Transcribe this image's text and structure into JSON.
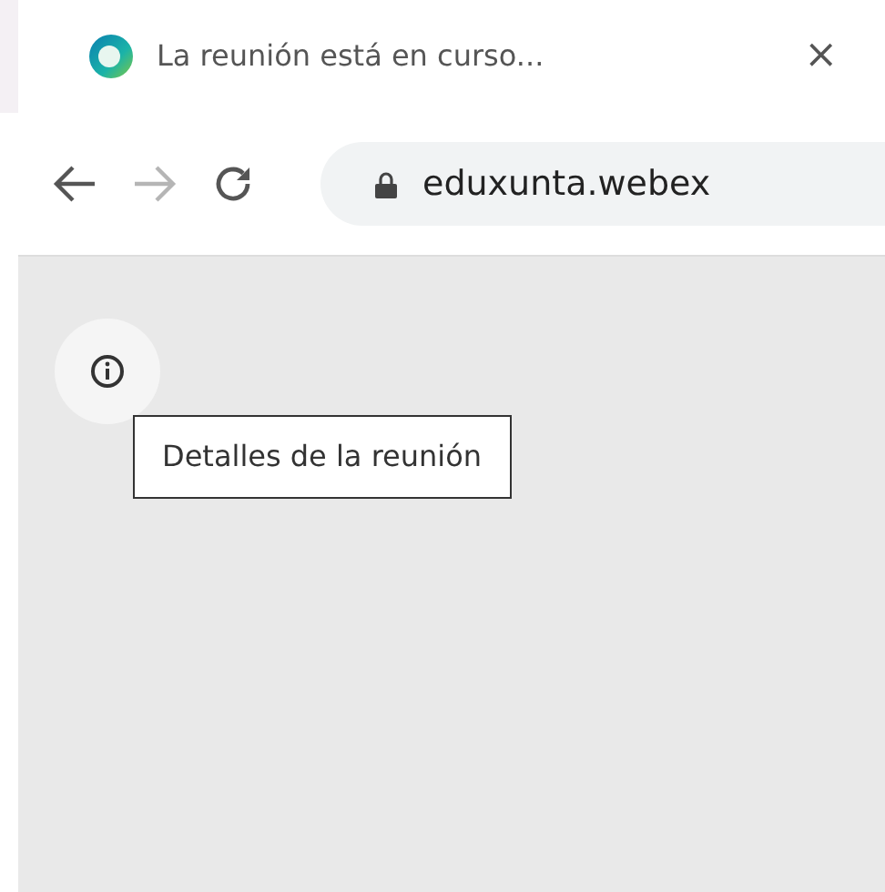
{
  "tab": {
    "title": "La reunión está en curso...",
    "close": "×"
  },
  "toolbar": {
    "back": {
      "disabled": false
    },
    "forward": {
      "disabled": true
    },
    "address": "eduxunta.webex"
  },
  "content": {
    "tooltip": "Detalles de la reunión"
  }
}
